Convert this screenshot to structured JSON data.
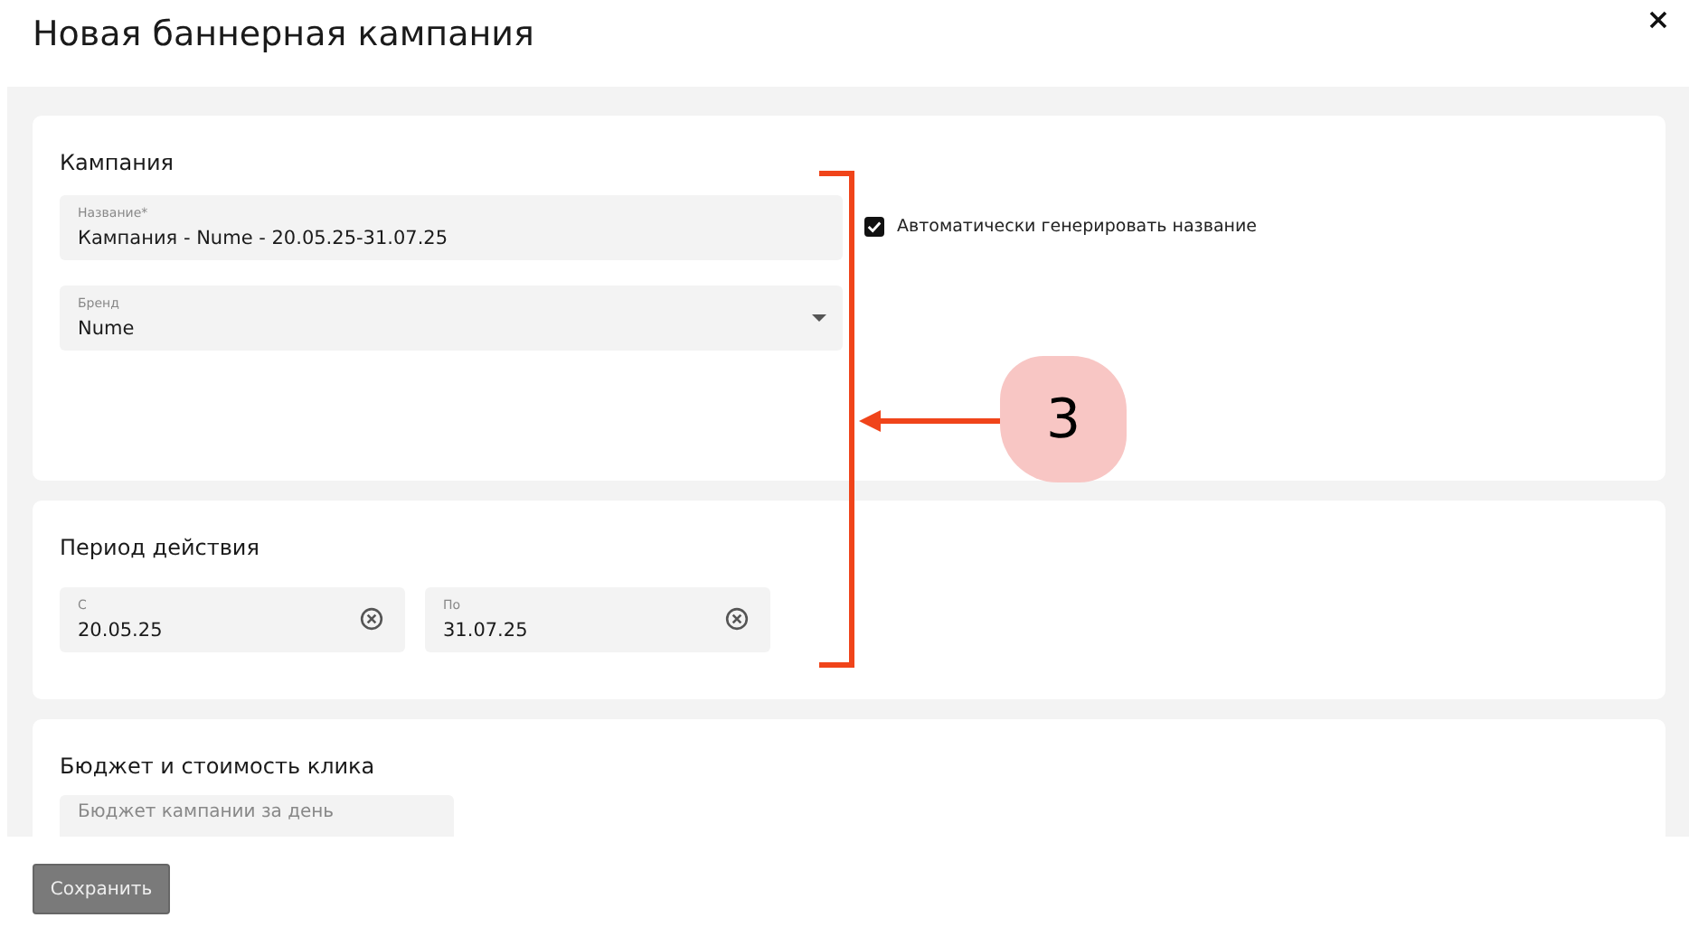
{
  "dialog": {
    "title": "Новая баннерная кампания"
  },
  "sections": [
    {
      "title": "Кампания",
      "fields": [
        {
          "kind": "text",
          "label": "Название*",
          "value": "Кампания - Nume - 20.05.25-31.07.25"
        },
        {
          "kind": "select",
          "label": "Бренд",
          "value": "Nume"
        }
      ],
      "checkbox": {
        "label": "Автоматически генерировать название",
        "checked": true
      }
    },
    {
      "title": "Период действия",
      "fields": [
        {
          "kind": "date",
          "label": "С",
          "value": "20.05.25"
        },
        {
          "kind": "date",
          "label": "По",
          "value": "31.07.25"
        }
      ]
    },
    {
      "title": "Бюджет и стоимость клика",
      "fields": [
        {
          "kind": "empty",
          "placeholder": "Бюджет кампании за день"
        }
      ]
    }
  ],
  "annotation": {
    "number": "3"
  },
  "save_button": "Сохранить"
}
